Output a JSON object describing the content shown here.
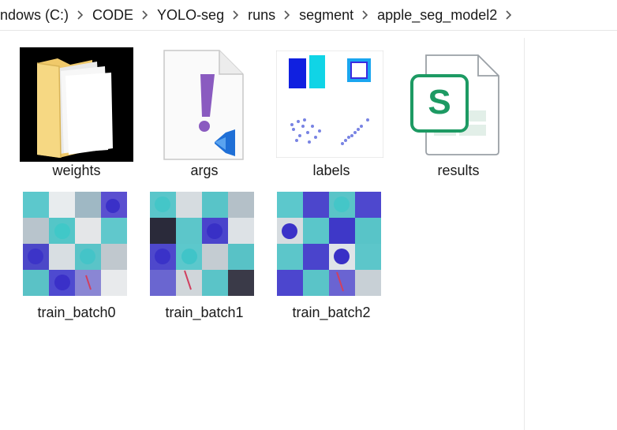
{
  "breadcrumb": {
    "items": [
      "ndows (C:)",
      "CODE",
      "YOLO-seg",
      "runs",
      "segment",
      "apple_seg_model2"
    ]
  },
  "files": [
    {
      "name": "weights",
      "icon": "folder-icon"
    },
    {
      "name": "args",
      "icon": "vscode-file-icon"
    },
    {
      "name": "labels",
      "icon": "image-thumbnail"
    },
    {
      "name": "results",
      "icon": "spreadsheet-icon"
    },
    {
      "name": "train_batch0",
      "icon": "image-thumbnail"
    },
    {
      "name": "train_batch1",
      "icon": "image-thumbnail"
    },
    {
      "name": "train_batch2",
      "icon": "image-thumbnail"
    }
  ],
  "colors": {
    "accent_blue": "#1f6fd6",
    "folder_yellow": "#f3cf72",
    "sheet_green": "#1d9a63",
    "exclam_purple": "#8a5bc0"
  }
}
